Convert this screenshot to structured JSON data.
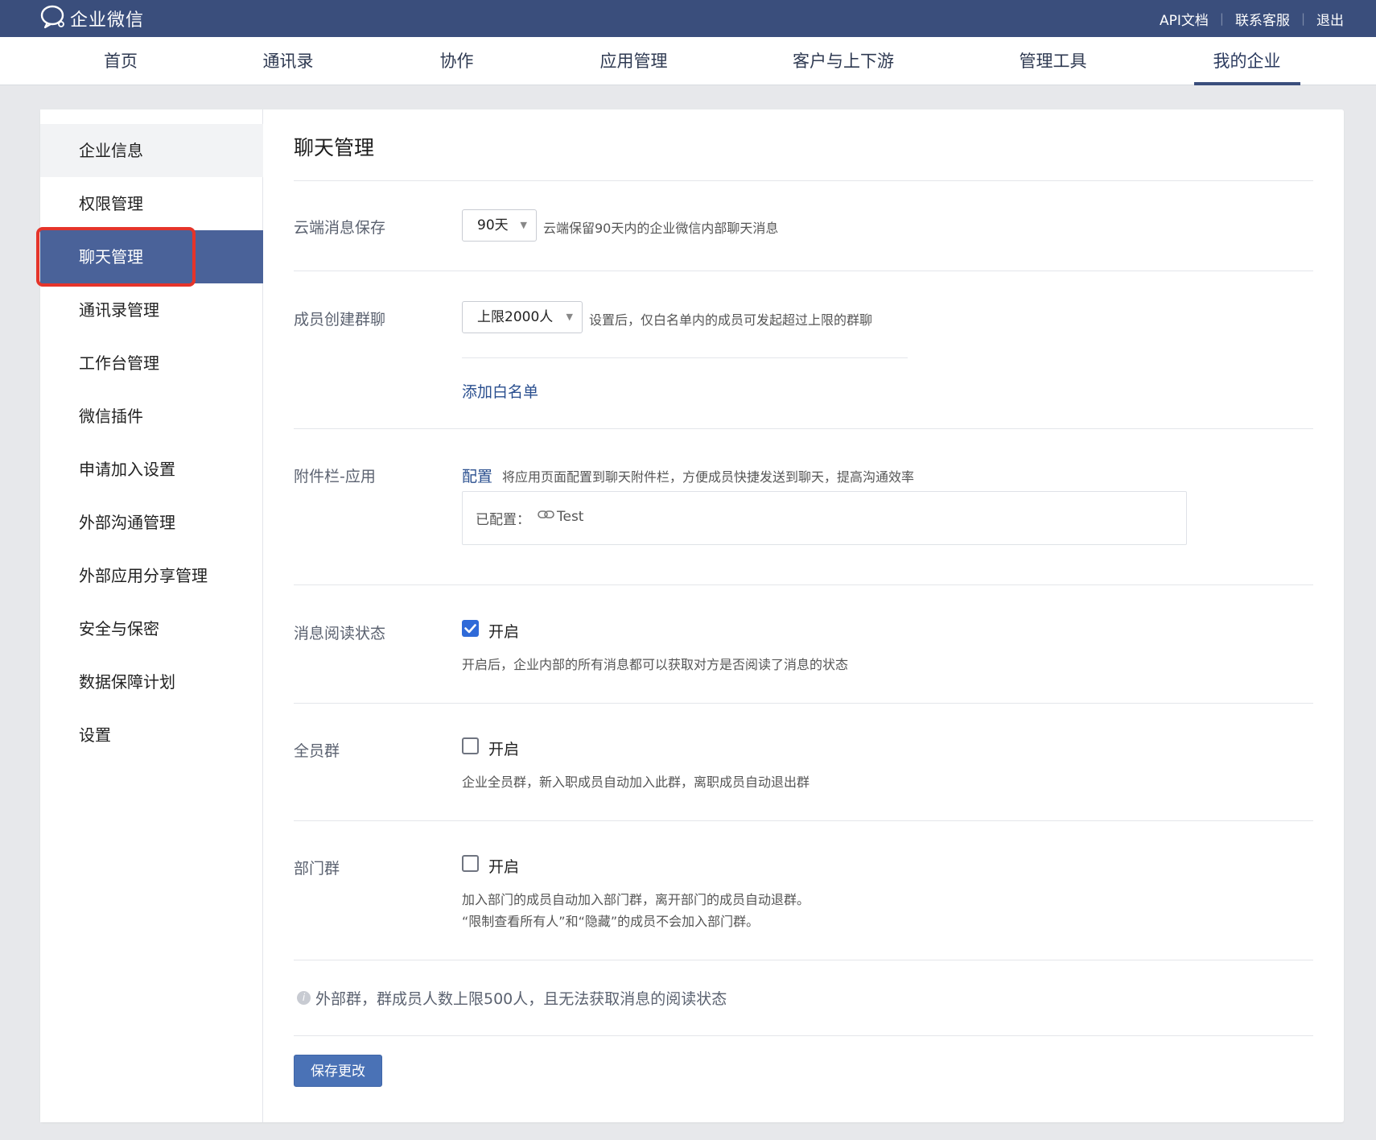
{
  "header": {
    "logo_text": "企业微信",
    "links": [
      "API文档",
      "联系客服",
      "退出"
    ]
  },
  "nav": {
    "items": [
      "首页",
      "通讯录",
      "协作",
      "应用管理",
      "客户与上下游",
      "管理工具",
      "我的企业"
    ],
    "active": "我的企业"
  },
  "sidebar": {
    "items": [
      "企业信息",
      "权限管理",
      "聊天管理",
      "通讯录管理",
      "工作台管理",
      "微信插件",
      "申请加入设置",
      "外部沟通管理",
      "外部应用分享管理",
      "安全与保密",
      "数据保障计划",
      "设置"
    ],
    "active": "聊天管理"
  },
  "main": {
    "title": "聊天管理",
    "cloud_storage": {
      "label": "云端消息保存",
      "select_value": "90天",
      "desc": "云端保留90天内的企业微信内部聊天消息"
    },
    "group_create": {
      "label": "成员创建群聊",
      "select_value": "上限2000人",
      "desc": "设置后，仅白名单内的成员可发起超过上限的群聊",
      "link": "添加白名单"
    },
    "attachment": {
      "label": "附件栏-应用",
      "link": "配置",
      "desc": "将应用页面配置到聊天附件栏，方便成员快捷发送到聊天，提高沟通效率",
      "configured_label": "已配置：",
      "configured_item": "Test"
    },
    "read_status": {
      "label": "消息阅读状态",
      "checked": true,
      "option": "开启",
      "desc": "开启后，企业内部的所有消息都可以获取对方是否阅读了消息的状态"
    },
    "all_members_group": {
      "label": "全员群",
      "checked": false,
      "option": "开启",
      "desc": "企业全员群，新入职成员自动加入此群，离职成员自动退出群"
    },
    "dept_group": {
      "label": "部门群",
      "checked": false,
      "option": "开启",
      "desc_line1": "加入部门的成员自动加入部门群，离开部门的成员自动退群。",
      "desc_line2": "“限制查看所有人”和“隐藏”的成员不会加入部门群。"
    },
    "note": "外部群，群成员人数上限500人，且无法获取消息的阅读状态",
    "save_button": "保存更改"
  },
  "colors": {
    "topbar": "#3a4e7c",
    "sidebar_active": "#4a6299",
    "link": "#2a4f8f",
    "checkbox_on": "#2f6ad8",
    "save_button": "#4a72b6",
    "highlight": "#e5342a"
  }
}
